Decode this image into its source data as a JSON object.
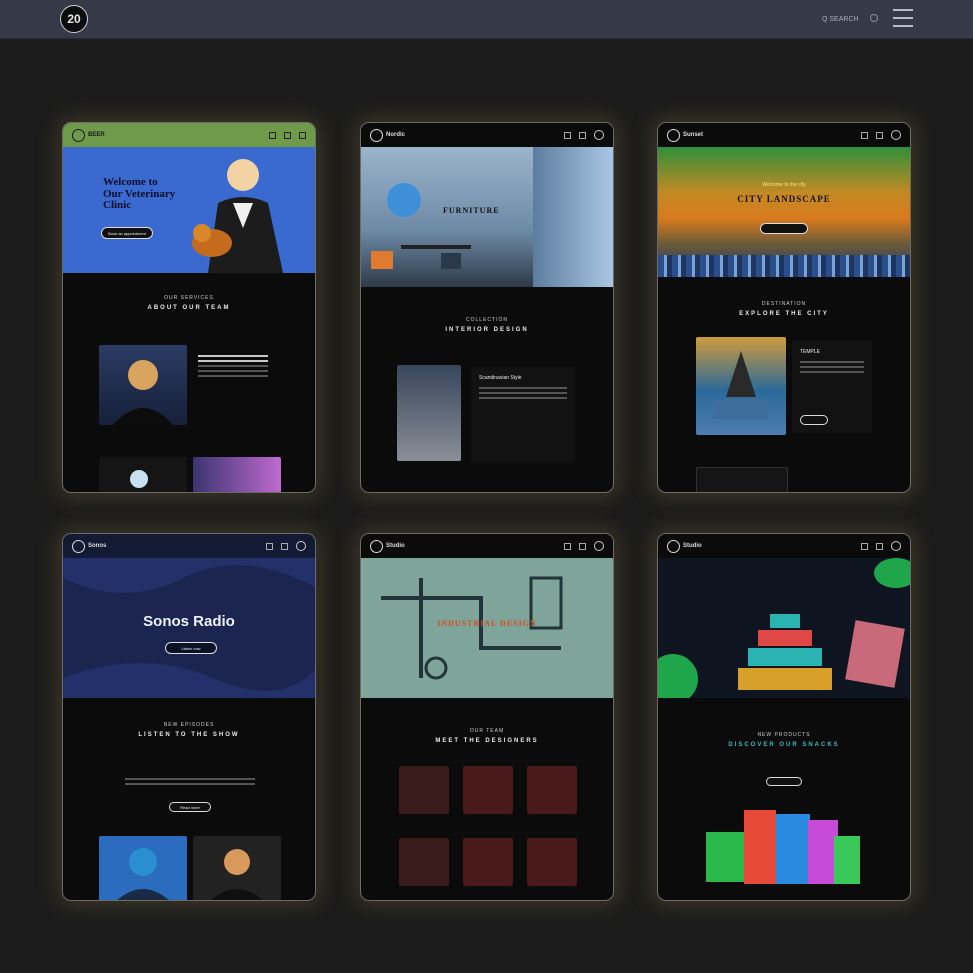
{
  "topbar": {
    "logo_text": "20",
    "search_label": "Q SEARCH"
  },
  "cards": [
    {
      "brand": "BEER",
      "hero_title": "Welcome to\nOur Veterinary\nClinic",
      "hero_button": "Book an appointment",
      "section_kicker": "OUR SERVICES",
      "section_title": "ABOUT OUR TEAM"
    },
    {
      "brand": "Nordic",
      "hero_title": "FURNITURE",
      "section_kicker": "COLLECTION",
      "section_title": "INTERIOR DESIGN",
      "feature_title": "Scandinavian Style"
    },
    {
      "brand": "Sunset",
      "hero_kicker": "Welcome to the city",
      "hero_title": "CITY LANDSCAPE",
      "section_kicker": "DESTINATION",
      "section_title": "EXPLORE THE CITY",
      "feature_title": "TEMPLE"
    },
    {
      "brand": "Sonos",
      "hero_title": "Sonos Radio",
      "hero_button": "Listen now",
      "section_kicker": "NEW EPISODES",
      "section_title": "LISTEN TO THE SHOW",
      "body_button": "Read more"
    },
    {
      "brand": "Studio",
      "hero_title": "INDUSTRIAL DESIGN",
      "section_kicker": "OUR TEAM",
      "section_title": "MEET THE DESIGNERS"
    },
    {
      "brand": "Studio",
      "section_kicker": "NEW PRODUCTS",
      "section_title": "DISCOVER OUR SNACKS"
    }
  ],
  "colors": {
    "page_bg": "#1c1c1c",
    "topbar_bg": "#363a48",
    "card_border": "#6b6b6b",
    "vet_hero_bg": "#3a6ad0",
    "vet_header_bg": "#6e9a4a",
    "city_sky_top": "#2f8f3a",
    "city_sky_mid": "#d87a1e",
    "sonos_bg": "#1b2550",
    "industrial_bg": "#7fa59a",
    "temple_bg": "#0e1420"
  }
}
